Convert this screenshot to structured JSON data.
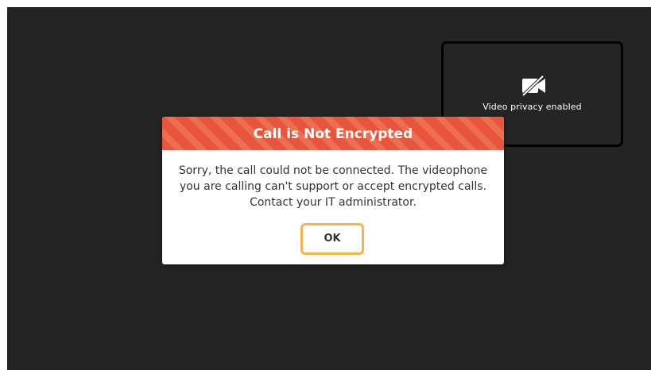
{
  "preview": {
    "icon": "video-camera-off-icon",
    "label": "Video privacy enabled"
  },
  "dialog": {
    "title": "Call is Not Encrypted",
    "message": "Sorry, the call could not be connected. The videophone you are calling can't support or accept encrypted calls. Contact your IT administrator.",
    "ok_label": "OK"
  },
  "colors": {
    "screen_background": "#242424",
    "header_primary": "#e8553a",
    "header_stripe": "#ec6f53",
    "button_focus_border": "#f7b24a"
  }
}
